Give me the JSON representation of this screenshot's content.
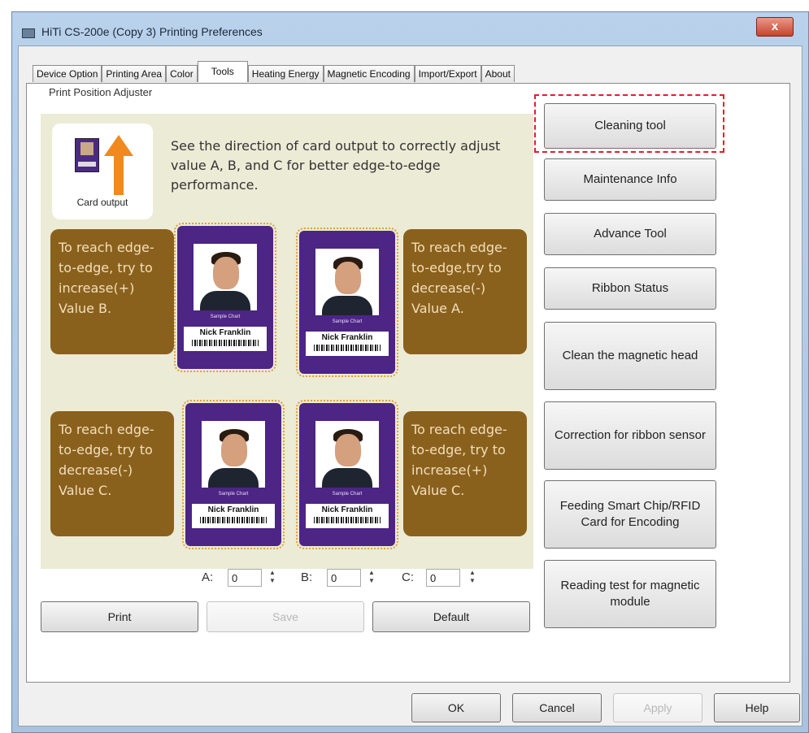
{
  "window": {
    "title": "HiTi CS-200e (Copy 3) Printing Preferences",
    "close_label": "x"
  },
  "tabs": [
    {
      "label": "Device Option"
    },
    {
      "label": "Printing Area"
    },
    {
      "label": "Color"
    },
    {
      "label": "Tools",
      "active": true
    },
    {
      "label": "Heating Energy"
    },
    {
      "label": "Magnetic Encoding"
    },
    {
      "label": "Import/Export"
    },
    {
      "label": "About"
    }
  ],
  "adjuster": {
    "group_label": "Print Position Adjuster",
    "card_output_label": "Card output",
    "instruction": "See the direction of card output to correctly adjust value A, B, and C for better edge-to-edge performance.",
    "tips": [
      "To reach edge-to-edge, try to increase(+) Value B.",
      "To reach edge-to-edge,try to decrease(-) Value A.",
      "To reach edge-to-edge, try to decrease(-) Value C.",
      "To reach edge-to-edge, try to increase(+) Value C."
    ],
    "card": {
      "name": "Nick Franklin",
      "sample_text": "Sample Chart"
    },
    "values": {
      "a_label": "A:",
      "a_value": "0",
      "b_label": "B:",
      "b_value": "0",
      "c_label": "C:",
      "c_value": "0"
    },
    "buttons": {
      "print": "Print",
      "save": "Save",
      "default": "Default"
    }
  },
  "tools": {
    "cleaning": "Cleaning tool",
    "maintenance": "Maintenance Info",
    "advance": "Advance Tool",
    "ribbon_status": "Ribbon Status",
    "clean_magnetic": "Clean the magnetic head",
    "correction_ribbon": "Correction for ribbon sensor",
    "feeding_smart": "Feeding Smart Chip/RFID Card for Encoding",
    "reading_test": "Reading test for magnetic module"
  },
  "dialog_buttons": {
    "ok": "OK",
    "cancel": "Cancel",
    "apply": "Apply",
    "help": "Help"
  },
  "colors": {
    "highlight": "#e0202a",
    "bubble": "#8a611c",
    "card": "#4c2585",
    "arrow": "#f1891f"
  }
}
